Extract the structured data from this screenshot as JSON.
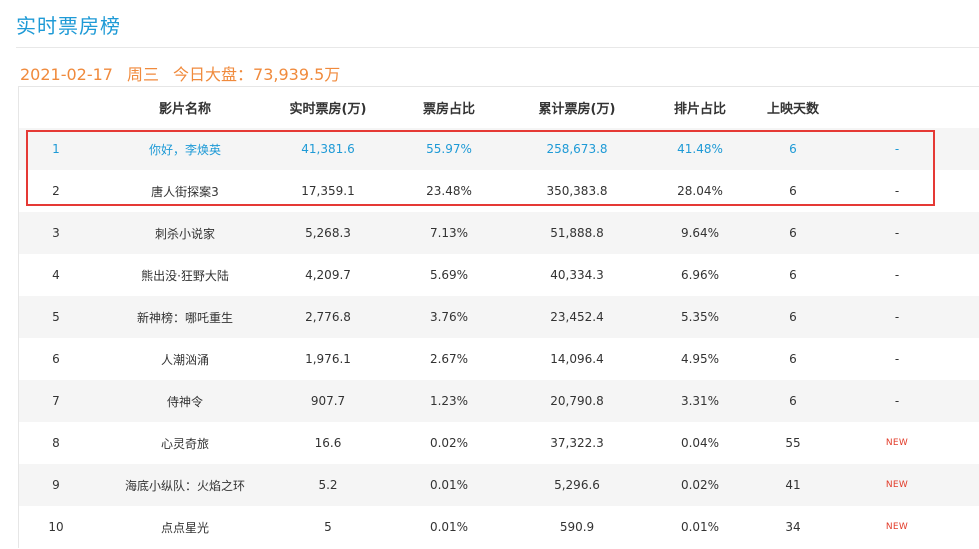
{
  "page_title": "实时票房榜",
  "summary": {
    "date": "2021-02-17",
    "weekday": "周三",
    "label": "今日大盘：",
    "value": "73,939.5万"
  },
  "table": {
    "headers": [
      "",
      "影片名称",
      "实时票房(万)",
      "票房占比",
      "累计票房(万)",
      "排片占比",
      "上映天数",
      ""
    ],
    "rows": [
      {
        "rank": "1",
        "name": "你好，李焕英",
        "realtime": "41,381.6",
        "share": "55.97%",
        "total": "258,673.8",
        "schedule": "41.48%",
        "days": "6",
        "tag": "-"
      },
      {
        "rank": "2",
        "name": "唐人街探案3",
        "realtime": "17,359.1",
        "share": "23.48%",
        "total": "350,383.8",
        "schedule": "28.04%",
        "days": "6",
        "tag": "-"
      },
      {
        "rank": "3",
        "name": "刺杀小说家",
        "realtime": "5,268.3",
        "share": "7.13%",
        "total": "51,888.8",
        "schedule": "9.64%",
        "days": "6",
        "tag": "-"
      },
      {
        "rank": "4",
        "name": "熊出没·狂野大陆",
        "realtime": "4,209.7",
        "share": "5.69%",
        "total": "40,334.3",
        "schedule": "6.96%",
        "days": "6",
        "tag": "-"
      },
      {
        "rank": "5",
        "name": "新神榜：哪吒重生",
        "realtime": "2,776.8",
        "share": "3.76%",
        "total": "23,452.4",
        "schedule": "5.35%",
        "days": "6",
        "tag": "-"
      },
      {
        "rank": "6",
        "name": "人潮汹涌",
        "realtime": "1,976.1",
        "share": "2.67%",
        "total": "14,096.4",
        "schedule": "4.95%",
        "days": "6",
        "tag": "-"
      },
      {
        "rank": "7",
        "name": "侍神令",
        "realtime": "907.7",
        "share": "1.23%",
        "total": "20,790.8",
        "schedule": "3.31%",
        "days": "6",
        "tag": "-"
      },
      {
        "rank": "8",
        "name": "心灵奇旅",
        "realtime": "16.6",
        "share": "0.02%",
        "total": "37,322.3",
        "schedule": "0.04%",
        "days": "55",
        "tag": "NEW"
      },
      {
        "rank": "9",
        "name": "海底小纵队：火焰之环",
        "realtime": "5.2",
        "share": "0.01%",
        "total": "5,296.6",
        "schedule": "0.02%",
        "days": "41",
        "tag": "NEW"
      },
      {
        "rank": "10",
        "name": "点点星光",
        "realtime": "5",
        "share": "0.01%",
        "total": "590.9",
        "schedule": "0.01%",
        "days": "34",
        "tag": "NEW"
      }
    ]
  },
  "colors": {
    "title": "#1e9ad6",
    "summary": "#f08a3c",
    "highlight_text": "#1e9ad6",
    "highlight_box": "#e53935",
    "new_tag": "#e23c2a",
    "stripe": "#f5f5f5"
  }
}
